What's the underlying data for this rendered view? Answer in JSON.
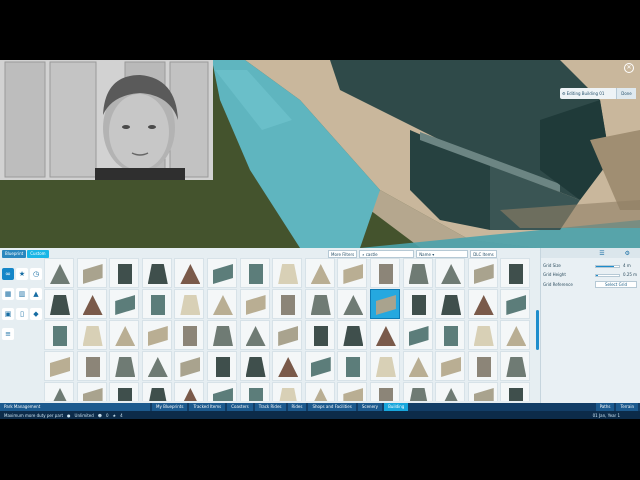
{
  "hud": {
    "editing_label": "Editing Building 01",
    "done_label": "Done",
    "close_icon": "close-icon"
  },
  "panel": {
    "tabs": [
      {
        "label": "Blueprint"
      },
      {
        "label": "Custom"
      }
    ],
    "filter": {
      "more_filters_label": "More Filters",
      "search_value": "castle",
      "sort_value": "Name",
      "dlc_label": "DLC Items"
    },
    "selected_item_index": 25,
    "grid_rows": 5,
    "grid_cols": 15
  },
  "properties": {
    "grid_size_label": "Grid Size",
    "grid_size_value": "4 m",
    "grid_height_label": "Grid Height",
    "grid_height_value": "0.25 m",
    "grid_reference_label": "Grid Reference",
    "select_grid_label": "Select Grid"
  },
  "bottom_bar": {
    "items": [
      {
        "label": "Park Management"
      },
      {
        "label": "My Blueprints"
      },
      {
        "label": "Tracked Items"
      },
      {
        "label": "Coasters"
      },
      {
        "label": "Track Rides"
      },
      {
        "label": "Rides"
      },
      {
        "label": "Shops and Facilities"
      },
      {
        "label": "Scenery"
      },
      {
        "label": "Building"
      },
      {
        "label": "Paths"
      },
      {
        "label": "Terrain"
      }
    ]
  },
  "status_bar": {
    "message": "Maximum more duty per part",
    "money": "Unlimited",
    "guests": "0",
    "rating": "4",
    "date": "01 Jan, Year 1"
  },
  "colors": {
    "accent": "#1586c8",
    "selected": "#25a8df",
    "bar": "#123d66"
  }
}
